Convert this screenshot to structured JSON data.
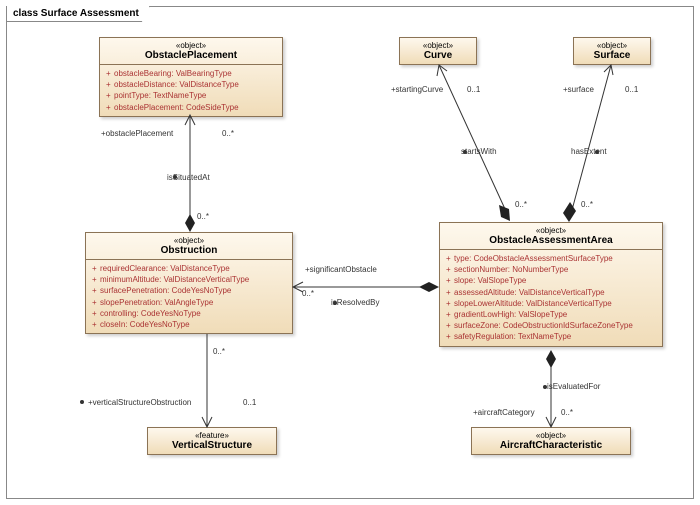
{
  "frame": {
    "label": "class Surface Assessment"
  },
  "classes": {
    "obstaclePlacement": {
      "stereotype": "«object»",
      "name": "ObstaclePlacement",
      "attrs": [
        "obstacleBearing: ValBearingType",
        "obstacleDistance: ValDistanceType",
        "pointType: TextNameType",
        "obstaclePlacement: CodeSideType"
      ]
    },
    "curve": {
      "stereotype": "«object»",
      "name": "Curve"
    },
    "surface": {
      "stereotype": "«object»",
      "name": "Surface"
    },
    "obstruction": {
      "stereotype": "«object»",
      "name": "Obstruction",
      "attrs": [
        "requiredClearance: ValDistanceType",
        "minimumAltitude: ValDistanceVerticalType",
        "surfacePenetration: CodeYesNoType",
        "slopePenetration: ValAngleType",
        "controlling: CodeYesNoType",
        "closeIn: CodeYesNoType"
      ]
    },
    "obstacleAssessmentArea": {
      "stereotype": "«object»",
      "name": "ObstacleAssessmentArea",
      "attrs": [
        "type: CodeObstacleAssessmentSurfaceType",
        "sectionNumber: NoNumberType",
        "slope: ValSlopeType",
        "assessedAltitude: ValDistanceVerticalType",
        "slopeLowerAltitude: ValDistanceVerticalType",
        "gradientLowHigh: ValSlopeType",
        "surfaceZone: CodeObstructionIdSurfaceZoneType",
        "safetyRegulation: TextNameType"
      ]
    },
    "verticalStructure": {
      "stereotype": "«feature»",
      "name": "VerticalStructure"
    },
    "aircraftCharacteristic": {
      "stereotype": "«object»",
      "name": "AircraftCharacteristic"
    }
  },
  "relations": {
    "isSituatedAt": {
      "label": "isSituatedAt",
      "role": "+obstaclePlacement",
      "mult": "0..*"
    },
    "startsWith": {
      "label": "startsWith",
      "role": "+startingCurve",
      "mult1": "0..1",
      "mult2": "0..*"
    },
    "hasExtent": {
      "label": "hasExtent",
      "role": "+surface",
      "mult1": "0..1",
      "mult2": "0..*"
    },
    "isResolvedBy": {
      "label": "isResolvedBy",
      "role": "+significantObstacle",
      "mult": "0..*"
    },
    "verticalStructureObstruction": {
      "role": "+verticalStructureObstruction",
      "mult1": "0..*",
      "mult2": "0..1"
    },
    "isEvaluatedFor": {
      "label": "isEvaluatedFor",
      "role": "+aircraftCategory",
      "mult": "0..*"
    }
  }
}
